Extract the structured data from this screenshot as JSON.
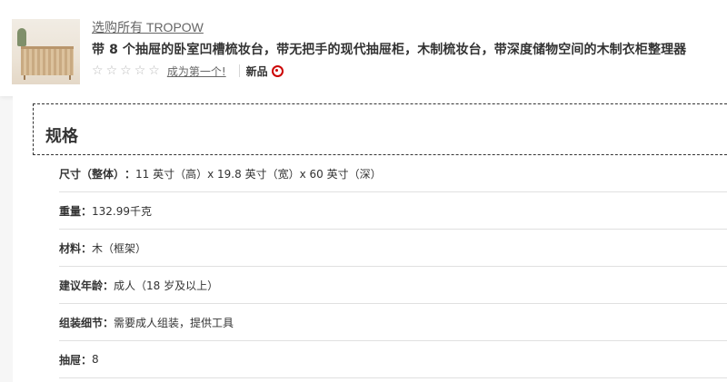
{
  "product": {
    "brand_link": "选购所有 TROPOW",
    "title": "带 8 个抽屉的卧室凹槽梳妆台，带无把手的现代抽屉柜，木制梳妆台，带深度储物空间的木制衣柜整理器",
    "rating": {
      "stars": [
        "☆",
        "☆",
        "☆",
        "☆",
        "☆"
      ],
      "first_review_link": "成为第一个!"
    },
    "badge": {
      "label": "新品",
      "icon": "target-icon",
      "icon_color": "#cc0000"
    }
  },
  "specs": {
    "heading": "规格",
    "rows": [
      {
        "key": "尺寸（整体）",
        "value": "11 英寸（高）x 19.8 英寸（宽）x 60 英寸（深）"
      },
      {
        "key": "重量",
        "value": "132.99千克"
      },
      {
        "key": "材料",
        "value": "木（框架）"
      },
      {
        "key": "建议年龄",
        "value": "成人（18 岁及以上）"
      },
      {
        "key": "组装细节",
        "value": "需要成人组装，提供工具"
      },
      {
        "key": "抽屉",
        "value": "8"
      }
    ]
  }
}
